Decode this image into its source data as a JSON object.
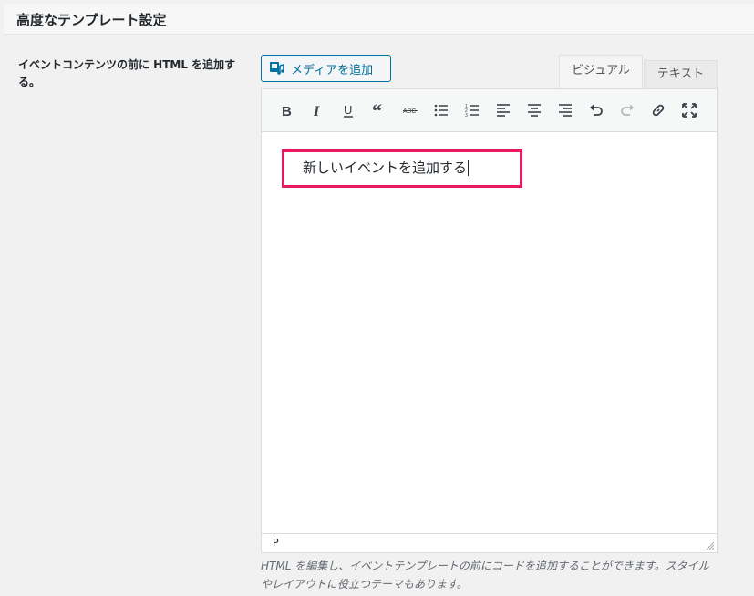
{
  "header": {
    "title": "高度なテンプレート設定"
  },
  "field": {
    "label": "イベントコンテンツの前に HTML を追加する。"
  },
  "media_button": {
    "label": "メディアを追加"
  },
  "tabs": {
    "visual": "ビジュアル",
    "text": "テキスト"
  },
  "toolbar": {
    "items": [
      "bold",
      "italic",
      "underline",
      "blockquote",
      "strikethrough",
      "bulleted-list",
      "numbered-list",
      "align-left",
      "align-center",
      "align-right",
      "undo",
      "redo",
      "link",
      "fullscreen"
    ]
  },
  "editor": {
    "content": "新しいイベントを追加する"
  },
  "statusbar": {
    "path": "P"
  },
  "description": {
    "text": "HTML を編集し、イベントテンプレートの前にコードを追加することができます。スタイルやレイアウトに役立つテーマもあります。"
  },
  "colors": {
    "accent": "#0071a1",
    "highlight": "#e8195d"
  }
}
